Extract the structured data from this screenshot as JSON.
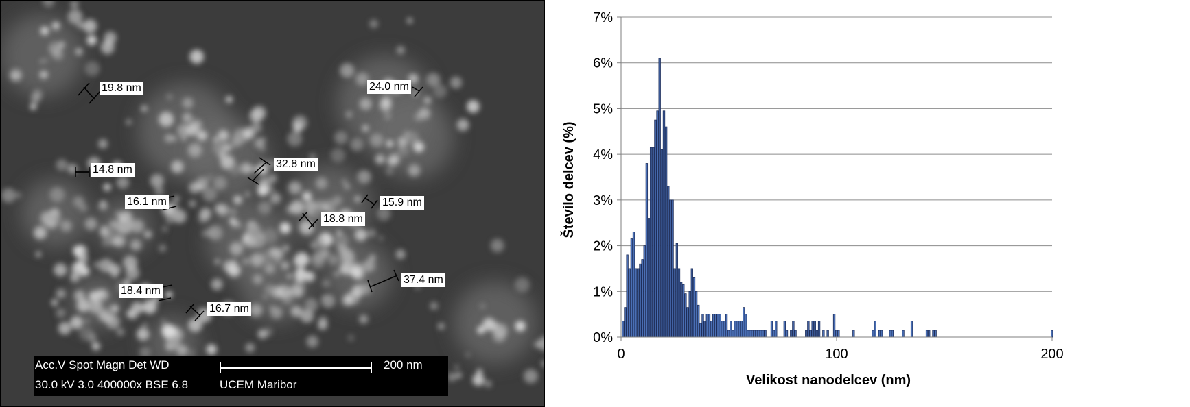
{
  "sem": {
    "labels": [
      "19.8 nm",
      "24.0 nm",
      "14.8 nm",
      "32.8 nm",
      "16.1 nm",
      "15.9 nm",
      "18.8 nm",
      "37.4 nm",
      "18.4 nm",
      "16.7 nm"
    ],
    "info": {
      "header": "Acc.V   Spot Magn     Det   WD",
      "values": "30.0 kV  3.0   400000x BSE  6.8",
      "scale_label": "200 nm",
      "lab": "UCEM Maribor"
    }
  },
  "chart_data": {
    "type": "bar",
    "title": "",
    "xlabel": "Velikost nanodelcev (nm)",
    "ylabel": "Število delcev (%)",
    "xlim": [
      0,
      200
    ],
    "ylim": [
      0,
      7
    ],
    "xticks": [
      "0",
      "100",
      "200"
    ],
    "yticks": [
      "0%",
      "1%",
      "2%",
      "3%",
      "4%",
      "5%",
      "6%",
      "7%"
    ],
    "grid": true,
    "bar_color": "#4a6fb5",
    "bin_width": 1,
    "x": [
      1,
      2,
      3,
      4,
      5,
      6,
      7,
      8,
      9,
      10,
      11,
      12,
      13,
      14,
      15,
      16,
      17,
      18,
      19,
      20,
      21,
      22,
      23,
      24,
      25,
      26,
      27,
      28,
      29,
      30,
      31,
      32,
      33,
      34,
      35,
      36,
      37,
      38,
      39,
      40,
      41,
      42,
      43,
      44,
      45,
      46,
      47,
      48,
      49,
      50,
      51,
      52,
      53,
      54,
      55,
      56,
      57,
      58,
      59,
      60,
      61,
      62,
      63,
      64,
      65,
      66,
      67,
      70,
      71,
      72,
      76,
      77,
      79,
      80,
      81,
      86,
      87,
      88,
      89,
      90,
      91,
      92,
      94,
      96,
      99,
      100,
      101,
      108,
      117,
      118,
      120,
      121,
      125,
      126,
      131,
      135,
      142,
      143,
      145,
      146,
      200
    ],
    "values": [
      0.35,
      0.65,
      1.8,
      1.5,
      2.15,
      2.3,
      1.5,
      1.5,
      1.6,
      1.7,
      2.0,
      3.8,
      2.6,
      4.15,
      4.15,
      4.75,
      4.95,
      6.1,
      4.1,
      4.95,
      4.6,
      3.3,
      3.0,
      3.0,
      1.5,
      2.05,
      1.5,
      1.2,
      1.15,
      0.95,
      0.65,
      1.0,
      1.5,
      1.3,
      1.0,
      0.7,
      0.3,
      0.5,
      0.35,
      0.5,
      0.5,
      0.35,
      0.5,
      0.5,
      0.5,
      0.5,
      0.35,
      0.35,
      0.5,
      0.15,
      0.35,
      0.15,
      0.35,
      0.35,
      0.35,
      0.35,
      0.65,
      0.5,
      0.15,
      0.15,
      0.15,
      0.15,
      0.15,
      0.15,
      0.15,
      0.15,
      0.15,
      0.35,
      0.15,
      0.35,
      0.35,
      0.15,
      0.15,
      0.35,
      0.15,
      0.15,
      0.35,
      0.15,
      0.35,
      0.35,
      0.15,
      0.35,
      0.15,
      0.15,
      0.5,
      0.15,
      0.15,
      0.15,
      0.15,
      0.35,
      0.15,
      0.15,
      0.15,
      0.15,
      0.15,
      0.35,
      0.15,
      0.15,
      0.15,
      0.15,
      0.15
    ]
  }
}
